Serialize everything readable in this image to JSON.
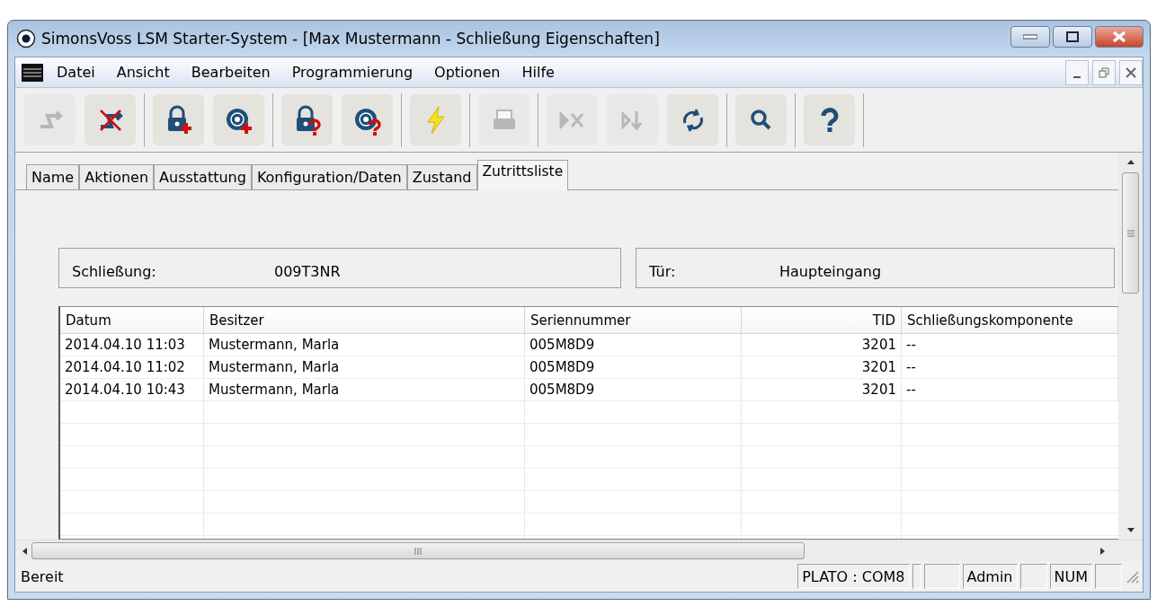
{
  "window": {
    "title": "SimonsVoss LSM Starter-System - [Max Mustermann - Schließung Eigenschaften]"
  },
  "menu": [
    "Datei",
    "Ansicht",
    "Bearbeiten",
    "Programmierung",
    "Optionen",
    "Hilfe"
  ],
  "toolbar": [
    [
      {
        "kind": "transfer",
        "disabled": true
      },
      {
        "kind": "transfer-cancel",
        "disabled": false
      }
    ],
    [
      {
        "kind": "lock-add",
        "disabled": false
      },
      {
        "kind": "cylinder-add",
        "disabled": false
      }
    ],
    [
      {
        "kind": "lock-query",
        "disabled": false
      },
      {
        "kind": "cylinder-query",
        "disabled": false
      }
    ],
    [
      {
        "kind": "flash",
        "disabled": false
      }
    ],
    [
      {
        "kind": "print",
        "disabled": true
      }
    ],
    [
      {
        "kind": "skip-cancel",
        "disabled": true
      },
      {
        "kind": "skip-down",
        "disabled": true
      },
      {
        "kind": "refresh",
        "disabled": false
      }
    ],
    [
      {
        "kind": "search",
        "disabled": false
      }
    ],
    [
      {
        "kind": "help",
        "disabled": false
      }
    ]
  ],
  "tabs": [
    {
      "label": "Name",
      "selected": false
    },
    {
      "label": "Aktionen",
      "selected": false
    },
    {
      "label": "Ausstattung",
      "selected": false
    },
    {
      "label": "Konfiguration/Daten",
      "selected": false
    },
    {
      "label": "Zustand",
      "selected": false
    },
    {
      "label": "Zutrittsliste",
      "selected": true
    }
  ],
  "info": [
    {
      "label": "Schließung:",
      "value": "009T3NR"
    },
    {
      "label": "Tür:",
      "value": "Haupteingang"
    }
  ],
  "table": {
    "columns": [
      "Datum",
      "Besitzer",
      "Seriennummer",
      "TID",
      "Schließungskomponente"
    ],
    "rows": [
      [
        "2014.04.10 11:03",
        "Mustermann, Marla",
        "005M8D9",
        "3201",
        "--"
      ],
      [
        "2014.04.10 11:02",
        "Mustermann, Marla",
        "005M8D9",
        "3201",
        "--"
      ],
      [
        "2014.04.10 10:43",
        "Mustermann, Marla",
        "005M8D9",
        "3201",
        "--"
      ]
    ]
  },
  "status_bar": {
    "text": "Bereit",
    "panes": [
      "PLATO : COM8",
      "Admin",
      "NUM"
    ]
  }
}
